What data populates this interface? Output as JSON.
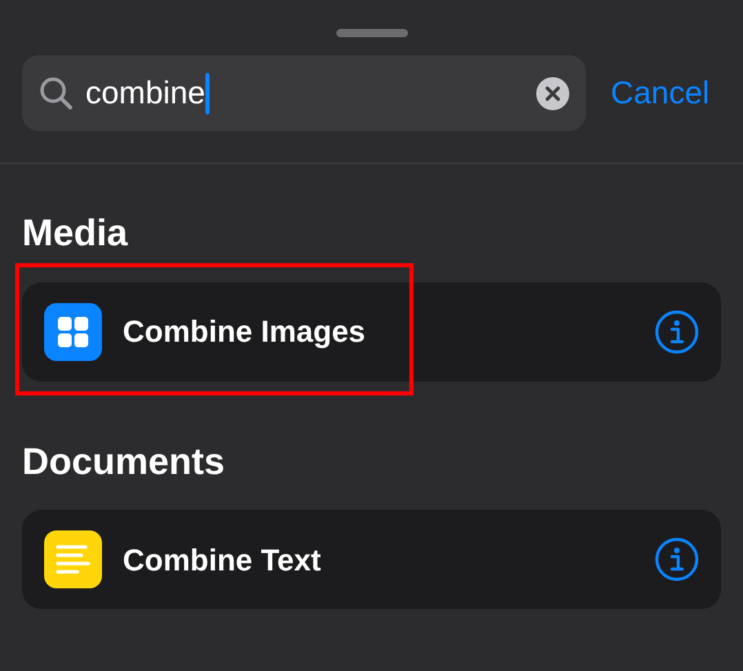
{
  "search": {
    "value": "combine",
    "focused": true,
    "cancel": "Cancel"
  },
  "sections": [
    {
      "title": "Media",
      "items": [
        {
          "label": "Combine Images",
          "kind": "grid",
          "highlighted": true
        }
      ]
    },
    {
      "title": "Documents",
      "items": [
        {
          "label": "Combine Text",
          "kind": "text",
          "highlighted": false
        }
      ]
    }
  ]
}
